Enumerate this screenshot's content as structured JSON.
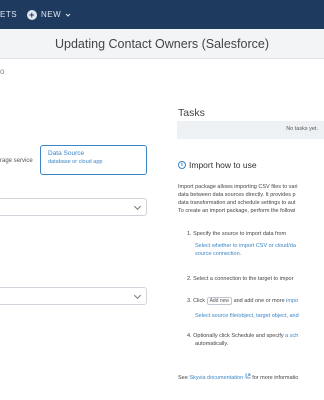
{
  "topbar": {
    "nav_partial": "ETS",
    "new_label": "NEW"
  },
  "page": {
    "title": "Updating Contact Owners (Salesforce)",
    "left_fragment": "o"
  },
  "source": {
    "active_title": "Data Source",
    "active_subtitle": "database or cloud app",
    "inactive_label": "rage service"
  },
  "tasks": {
    "title": "Tasks",
    "empty": "No tasks yet."
  },
  "howto": {
    "title": "Import how to use",
    "intro": [
      "Import package allows importing CSV files to vari",
      "data between data sources directly. It provides p",
      "data transformation and schedule settings to aut",
      "To create an import package, perform the followi"
    ],
    "step1": "1. Specify the source to import data from",
    "step1_link1": "Select whether to import CSV or cloud/da",
    "step1_link2": "source connection.",
    "step2": "2. Select a connection to the target to impor",
    "step3_prefix": "3. Click",
    "step3_tag": "Add new",
    "step3_suffix": "and add one or more",
    "step3_link": "impo",
    "step3_sub": "Select source file/object, target object, and",
    "step4_prefix": "4. Optionally click Schedule and specify",
    "step4_link": "a sch",
    "step4_line2": "automatically.",
    "footer_prefix": "See",
    "footer_link": "Skyvia documentation",
    "footer_suffix": "for more informatio"
  }
}
